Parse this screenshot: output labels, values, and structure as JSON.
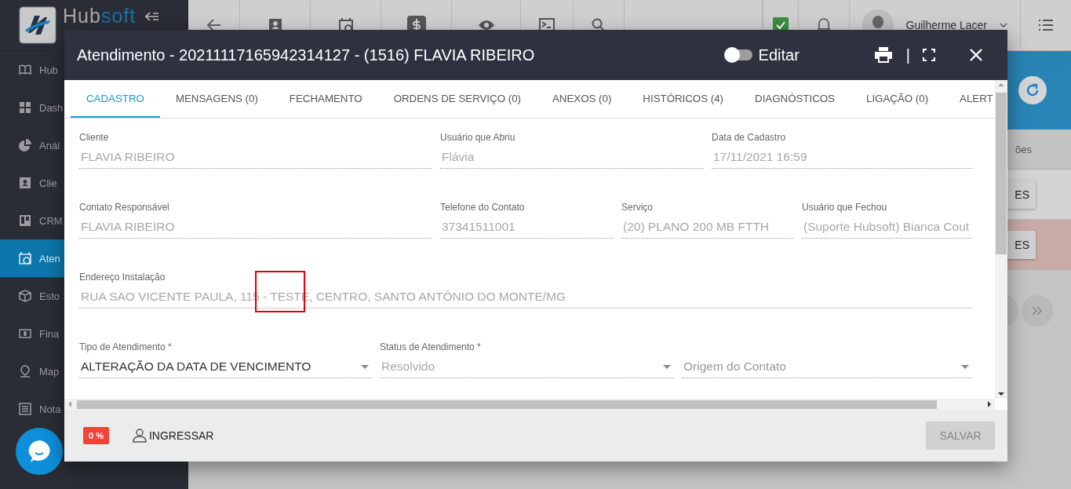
{
  "sidebar": {
    "logo_text": [
      "Hub",
      "soft"
    ],
    "items": [
      {
        "label": "Hub",
        "selected": false
      },
      {
        "label": "Dash",
        "selected": false
      },
      {
        "label": "Anál",
        "selected": false
      },
      {
        "label": "Clie",
        "selected": false
      },
      {
        "label": "CRM",
        "selected": false
      },
      {
        "label": "Aten",
        "selected": true
      },
      {
        "label": "Esto",
        "selected": false
      },
      {
        "label": "Fina",
        "selected": false
      },
      {
        "label": "Map",
        "selected": false
      },
      {
        "label": "Nota",
        "selected": false
      }
    ]
  },
  "topbar": {
    "user_name": "Guilherme Lacer"
  },
  "background": {
    "tab_fragment": "ões",
    "rows": [
      {
        "button": "ES",
        "kind": "normal"
      },
      {
        "button": "ES",
        "kind": "alert"
      }
    ]
  },
  "dialog": {
    "title": "Atendimento - 20211117165942314127 - (1516) FLAVIA RIBEIRO",
    "edit_toggle": {
      "label": "Editar",
      "on": false
    },
    "separator": "|",
    "tabs": [
      {
        "label": "CADASTRO",
        "selected": true
      },
      {
        "label": "MENSAGENS (0)",
        "selected": false
      },
      {
        "label": "FECHAMENTO",
        "selected": false
      },
      {
        "label": "ORDENS DE SERVIÇO (0)",
        "selected": false
      },
      {
        "label": "ANEXOS (0)",
        "selected": false
      },
      {
        "label": "HISTÓRICOS (4)",
        "selected": false
      },
      {
        "label": "DIAGNÓSTICOS",
        "selected": false
      },
      {
        "label": "LIGAÇÃO (0)",
        "selected": false
      },
      {
        "label": "ALERT",
        "selected": false
      }
    ],
    "field_rows": [
      [
        {
          "kind": "text",
          "label": "Cliente",
          "value": "FLAVIA RIBEIRO",
          "disabled": true
        },
        {
          "kind": "text",
          "label": "Usuário que Abriu",
          "value": "Flávia",
          "disabled": true
        },
        {
          "kind": "text",
          "label": "Data de Cadastro",
          "value": "17/11/2021 16:59",
          "disabled": true
        }
      ],
      [
        {
          "kind": "text",
          "label": "Contato Responsável",
          "value": "FLAVIA RIBEIRO",
          "disabled": true
        },
        {
          "kind": "text",
          "label": "Telefone do Contato",
          "value": "37341511001",
          "disabled": true
        },
        {
          "kind": "text",
          "label": "Serviço",
          "value": "(20) PLANO 200 MB FTTH",
          "disabled": true
        },
        {
          "kind": "text",
          "label": "Usuário que Fechou",
          "value": "(Suporte Hubsoft) Bianca Cout",
          "disabled": true
        }
      ],
      [
        {
          "kind": "text",
          "label": "Endereço Instalação",
          "value": "RUA SAO VICENTE PAULA, 115 - TESTE, CENTRO, SANTO ANTÔNIO DO MONTE/MG",
          "disabled": true,
          "highlighted": true
        }
      ],
      [
        {
          "kind": "select",
          "label": "Tipo de Atendimento *",
          "value": "ALTERAÇÃO DA DATA DE VENCIMENTO",
          "disabled": false
        },
        {
          "kind": "select",
          "label": "Status de Atendimento *",
          "value": "Resolvido",
          "disabled": true
        },
        {
          "kind": "select",
          "placeholder": "Origem do Contato"
        }
      ]
    ],
    "footer": {
      "progress_badge": "0 %",
      "join_button": "INGRESSAR",
      "save_button": {
        "label": "SALVAR",
        "disabled": true
      }
    }
  }
}
